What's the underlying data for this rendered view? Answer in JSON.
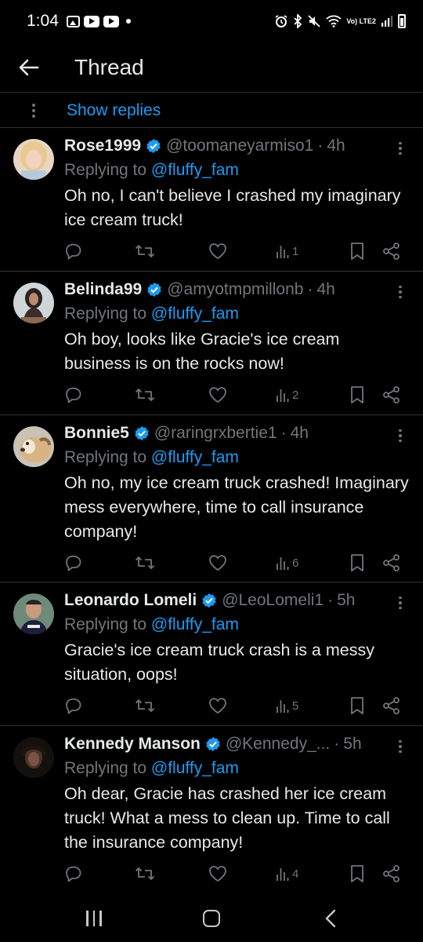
{
  "status_bar": {
    "time": "1:04",
    "network": "Vo) LTE2"
  },
  "header": {
    "title": "Thread"
  },
  "thread": {
    "show_replies_label": "Show replies"
  },
  "tweets": [
    {
      "name": "Rose1999",
      "handle": "@toomaneyarmiso1",
      "time": "4h",
      "replying_prefix": "Replying to",
      "replying_to": "@fluffy_fam",
      "text": "Oh no, I can't believe I crashed my imaginary ice cream truck!",
      "views": "1"
    },
    {
      "name": "Belinda99",
      "handle": "@amyotmpmillonb",
      "time": "4h",
      "replying_prefix": "Replying to",
      "replying_to": "@fluffy_fam",
      "text": "Oh boy, looks like Gracie's ice cream business is on the rocks now!",
      "views": "2"
    },
    {
      "name": "Bonnie5",
      "handle": "@raringrxbertie1",
      "time": "4h",
      "replying_prefix": "Replying to",
      "replying_to": "@fluffy_fam",
      "text": "Oh no, my ice cream truck crashed! Imaginary mess everywhere, time to call insurance company!",
      "views": "6"
    },
    {
      "name": "Leonardo Lomeli",
      "handle": "@LeoLomeli1",
      "time": "5h",
      "replying_prefix": "Replying to",
      "replying_to": "@fluffy_fam",
      "text": "Gracie's ice cream truck crash is a messy situation, oops!",
      "views": "5"
    },
    {
      "name": "Kennedy Manson",
      "handle": "@Kennedy_...",
      "time": "5h",
      "replying_prefix": "Replying to",
      "replying_to": "@fluffy_fam",
      "text": "Oh dear, Gracie has crashed her ice cream truck! What a mess to clean up. Time to call the insurance company!",
      "views": "4"
    }
  ],
  "colors": {
    "background": "#000000",
    "text": "#e7e9ea",
    "muted": "#71767b",
    "accent": "#1d9bf0",
    "divider": "#2f3336"
  },
  "icons": {
    "back": "arrow-left-icon",
    "verified": "verified-badge-icon",
    "reply": "reply-icon",
    "retweet": "retweet-icon",
    "like": "heart-icon",
    "views": "views-icon",
    "bookmark": "bookmark-icon",
    "share": "share-icon",
    "more": "more-vertical-icon"
  }
}
